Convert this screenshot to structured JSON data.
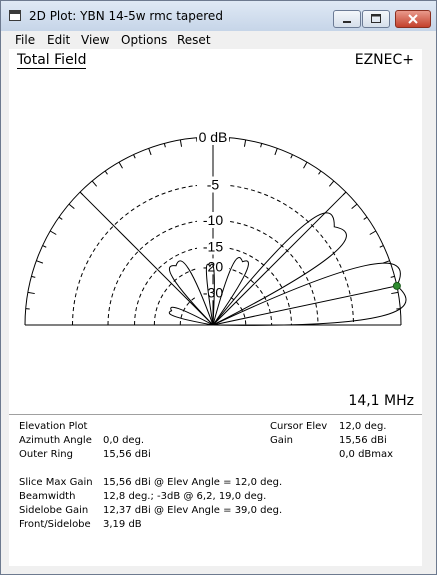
{
  "window": {
    "title": "2D Plot: YBN 14-5w rmc tapered",
    "title_icon": "plot-window-icon",
    "controls": [
      "minimize-icon",
      "maximize-icon",
      "close-icon"
    ],
    "close_color": "#c3412c"
  },
  "menu": {
    "items": [
      "File",
      "Edit",
      "View",
      "Options",
      "Reset"
    ]
  },
  "plot": {
    "title": "Total Field",
    "brand": "EZNEC+",
    "frequency": "14,1 MHz",
    "ring_labels": [
      "0 dB",
      "-5",
      "-10",
      "-15",
      "-20",
      "-30"
    ],
    "pattern_color": "#000000",
    "cursor_color": "#2e8b2e"
  },
  "chart_data": {
    "type": "polar",
    "plot_kind": "elevation",
    "angle_range_deg": [
      0,
      180
    ],
    "ring_levels_db": [
      0,
      -5,
      -10,
      -15,
      -20,
      -30
    ],
    "lobes": [
      {
        "peak_elev_deg": 12.0,
        "peak_db": 0.0,
        "width_deg": 13
      },
      {
        "peak_elev_deg": 39.0,
        "peak_db": -3.2,
        "width_deg": 12
      },
      {
        "peak_elev_deg": 65.0,
        "peak_db": -17.0,
        "width_deg": 10
      },
      {
        "peak_elev_deg": 93.0,
        "peak_db": -20.0,
        "width_deg": 6
      },
      {
        "peak_elev_deg": 122.0,
        "peak_db": -17.0,
        "width_deg": 12
      },
      {
        "peak_elev_deg": 161.0,
        "peak_db": -25.0,
        "width_deg": 9
      }
    ],
    "cursor_elev_deg": 12.0,
    "grid": true
  },
  "info": {
    "left_labels": [
      "Elevation Plot",
      "Azimuth Angle",
      "Outer Ring",
      "Slice Max Gain",
      "Beamwidth",
      "Sidelobe Gain",
      "Front/Sidelobe"
    ],
    "left_values": [
      "",
      "0,0 deg.",
      "15,56 dBi",
      "15,56 dBi @ Elev Angle = 12,0 deg.",
      "12,8 deg.; -3dB @ 6,2, 19,0 deg.",
      "12,37 dBi @ Elev Angle = 39,0 deg.",
      "3,19 dB"
    ],
    "right_labels": [
      "Cursor Elev",
      "Gain",
      ""
    ],
    "right_values": [
      "12,0 deg.",
      "15,56 dBi",
      "0,0 dBmax"
    ]
  }
}
